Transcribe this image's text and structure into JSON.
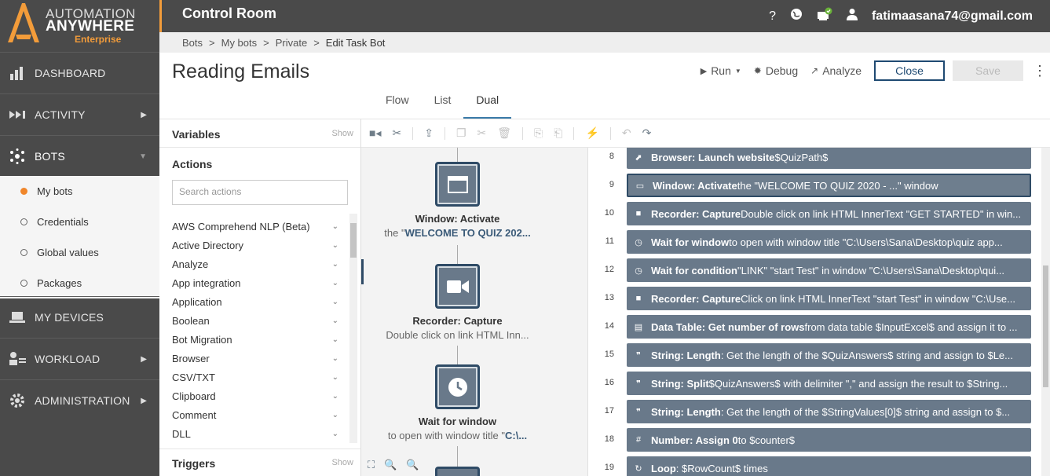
{
  "brand": {
    "line1": "AUTOMATION",
    "line2": "ANYWHERE",
    "line3": "Enterprise"
  },
  "nav": {
    "items": [
      {
        "label": "DASHBOARD",
        "icon": "dashboard-icon"
      },
      {
        "label": "ACTIVITY",
        "icon": "activity-icon"
      },
      {
        "label": "BOTS",
        "icon": "bots-icon"
      },
      {
        "label": "MY DEVICES",
        "icon": "devices-icon"
      },
      {
        "label": "WORKLOAD",
        "icon": "workload-icon"
      },
      {
        "label": "ADMINISTRATION",
        "icon": "administration-icon"
      }
    ],
    "subitems": [
      {
        "label": "My bots"
      },
      {
        "label": "Credentials"
      },
      {
        "label": "Global values"
      },
      {
        "label": "Packages"
      }
    ]
  },
  "header": {
    "title": "Control Room",
    "email": "fatimaasana74@gmail.com"
  },
  "breadcrumb": {
    "c1": "Bots",
    "c2": "My bots",
    "c3": "Private",
    "c4": "Edit Task Bot",
    "sep": ">"
  },
  "page": {
    "title": "Reading Emails"
  },
  "tabs": [
    {
      "label": "Flow"
    },
    {
      "label": "List"
    },
    {
      "label": "Dual"
    }
  ],
  "toolbar": {
    "run": "Run",
    "debug": "Debug",
    "analyze": "Analyze",
    "close": "Close",
    "save": "Save"
  },
  "sidebar": {
    "variables": "Variables",
    "actions": "Actions",
    "show": "Show",
    "search_placeholder": "Search actions",
    "triggers": "Triggers",
    "action_list": [
      "AWS Comprehend NLP (Beta)",
      "Active Directory",
      "Analyze",
      "App integration",
      "Application",
      "Boolean",
      "Bot Migration",
      "Browser",
      "CSV/TXT",
      "Clipboard",
      "Comment",
      "DLL"
    ]
  },
  "flow": {
    "nodes": [
      {
        "name": "Window: Activate",
        "desc_pre": "the \"",
        "desc_bold": "WELCOME TO QUIZ 202...",
        "icon": "window-icon"
      },
      {
        "name": "Recorder: Capture",
        "desc_pre": "Double click on link HTML Inn...",
        "desc_bold": "",
        "icon": "camera-icon"
      },
      {
        "name": "Wait for window",
        "desc_pre": "to open with window title \"",
        "desc_bold": "C:\\...",
        "icon": "clock-icon"
      }
    ]
  },
  "list": {
    "rows": [
      {
        "n": "8",
        "b": "Browser: Launch website",
        "t": " $QuizPath$",
        "icon": "launch-icon"
      },
      {
        "n": "9",
        "b": "Window: Activate",
        "t": " the \"WELCOME TO QUIZ 2020 - ...\" window",
        "icon": "window-icon"
      },
      {
        "n": "10",
        "b": "Recorder: Capture",
        "t": " Double click on link HTML InnerText \"GET STARTED\" in win...",
        "icon": "camera-icon"
      },
      {
        "n": "11",
        "b": "Wait for window",
        "t": " to open with window title \"C:\\Users\\Sana\\Desktop\\quiz app...",
        "icon": "clock-icon"
      },
      {
        "n": "12",
        "b": "Wait for condition",
        "t": " \"LINK\" \"start Test\" in window \"C:\\Users\\Sana\\Desktop\\qui...",
        "icon": "clock-icon"
      },
      {
        "n": "13",
        "b": "Recorder: Capture",
        "t": " Click on link HTML InnerText \"start Test\" in window \"C:\\Use...",
        "icon": "camera-icon"
      },
      {
        "n": "14",
        "b": "Data Table: Get number of rows",
        "t": " from data table $InputExcel$ and assign it to ...",
        "icon": "table-icon"
      },
      {
        "n": "15",
        "b": "String: Length",
        "t": " : Get the length of the $QuizAnswers$ string and assign to $Le...",
        "icon": "quote-icon"
      },
      {
        "n": "16",
        "b": "String: Split",
        "t": " $QuizAnswers$ with delimiter \",\" and assign the result to $String...",
        "icon": "quote-icon"
      },
      {
        "n": "17",
        "b": "String: Length",
        "t": " : Get the length of the $StringValues[0]$ string and assign to $...",
        "icon": "quote-icon"
      },
      {
        "n": "18",
        "b": "Number: Assign 0",
        "t": " to $counter$",
        "icon": "hash-icon"
      },
      {
        "n": "19",
        "b": "Loop",
        "t": " : $RowCount$ times",
        "icon": "loop-icon"
      }
    ]
  }
}
